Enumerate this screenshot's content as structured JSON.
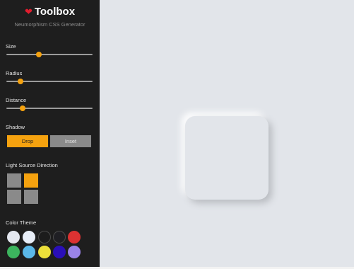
{
  "brand": {
    "icon": "heart-icon",
    "title": "Toolbox",
    "subtitle": "Neumorphism CSS Generator"
  },
  "controls": {
    "size": {
      "label": "Size",
      "value": 0.38
    },
    "radius": {
      "label": "Radius",
      "value": 0.16
    },
    "distance": {
      "label": "Distance",
      "value": 0.19
    }
  },
  "shadow": {
    "label": "Shadow",
    "drop": "Drop",
    "inset": "Inset",
    "selected": "Drop"
  },
  "light_source": {
    "label": "Light Source Direction",
    "selected": "top-right",
    "options": [
      "top-left",
      "top-right",
      "bottom-left",
      "bottom-right"
    ]
  },
  "color_theme": {
    "label": "Color Theme",
    "swatches": [
      "#e4e8f0",
      "#e8eef8",
      "#1c1c1c",
      "#1f1f24",
      "#dc3232",
      "#3cb55e",
      "#5bb8e9",
      "#ecdf3a",
      "#2a0fb8",
      "#9a83e8"
    ]
  },
  "colors": {
    "accent": "#f5a20f",
    "sidebar": "#1e1e1e",
    "canvas": "#e2e5ea"
  }
}
